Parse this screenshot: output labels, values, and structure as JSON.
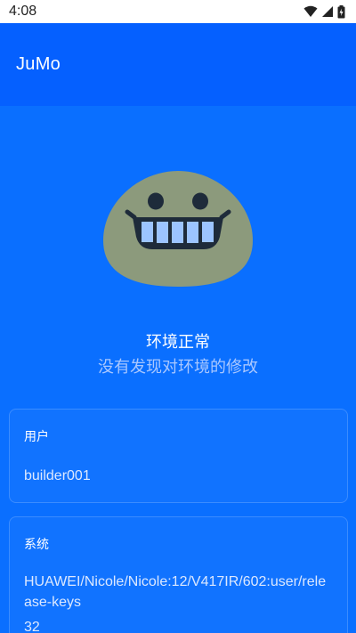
{
  "status_bar": {
    "time": "4:08",
    "icons": [
      "wifi-icon",
      "signal-icon",
      "battery-charging-icon"
    ]
  },
  "app_bar": {
    "title": "JuMo",
    "color": "#0560FF"
  },
  "status": {
    "icon": "grinning-face-icon",
    "title": "环境正常",
    "subtitle": "没有发现对环境的修改"
  },
  "cards": {
    "user": {
      "label": "用户",
      "value": "builder001"
    },
    "system": {
      "label": "系统",
      "value": "HUAWEI/Nicole/Nicole:12/V417IR/602:user/release-keys",
      "extra": "32"
    }
  },
  "colors": {
    "background": "#0A6FFF",
    "face": "#8C9A7C",
    "teeth": "#9CC4FF"
  }
}
